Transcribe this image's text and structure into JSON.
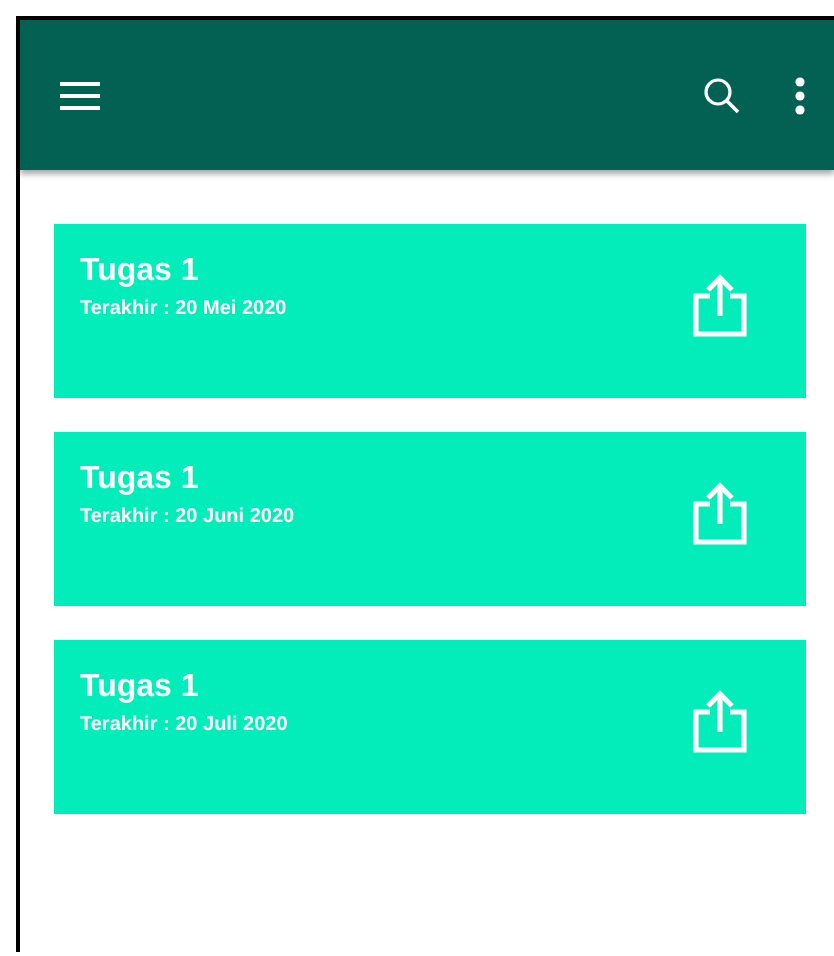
{
  "tasks": [
    {
      "title": "Tugas 1",
      "deadline": "Terakhir : 20 Mei 2020"
    },
    {
      "title": "Tugas 1",
      "deadline": "Terakhir : 20 Juni 2020"
    },
    {
      "title": "Tugas 1",
      "deadline": "Terakhir : 20 Juli 2020"
    }
  ]
}
